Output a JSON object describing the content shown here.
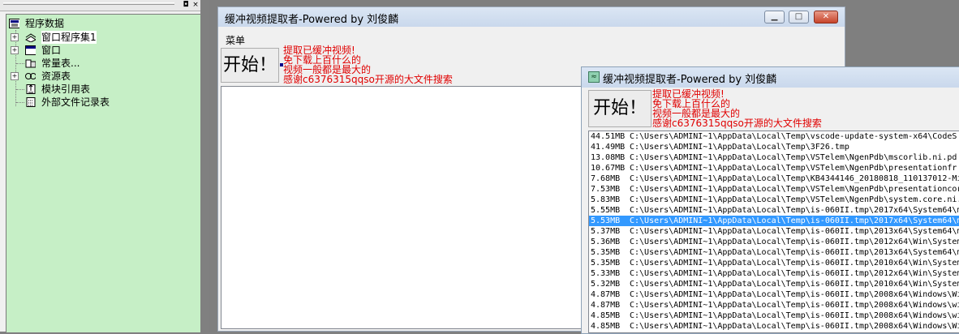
{
  "tree": {
    "root": "程序数据",
    "items": [
      {
        "label": "窗口程序集1",
        "icon": "module-icon",
        "expandable": true
      },
      {
        "label": "窗口",
        "icon": "window-icon",
        "expandable": true
      },
      {
        "label": "常量表...",
        "icon": "constant-icon",
        "expandable": false
      },
      {
        "label": "资源表",
        "icon": "resource-icon",
        "expandable": true
      },
      {
        "label": "模块引用表",
        "icon": "module-ref-icon",
        "expandable": false
      },
      {
        "label": "外部文件记录表",
        "icon": "file-icon",
        "expandable": false
      }
    ]
  },
  "left_panel": {
    "restore_glyph": "◘",
    "close_glyph": "×"
  },
  "win1": {
    "title": "缓冲视频提取者-Powered by 刘俊麟",
    "menu": "菜单",
    "start": "开始！",
    "notes": [
      "提取已缓冲视频!",
      "免下载上百什么的",
      "视频一般都是最大的",
      "感谢c6376315qqso开源的大文件搜索"
    ]
  },
  "win2": {
    "title": "缓冲视频提取者-Powered by 刘俊麟",
    "start": "开始！",
    "notes": [
      "提取已缓冲视频!",
      "免下载上百什么的",
      "视频一般都是最大的",
      "感谢c6376315qqso开源的大文件搜索"
    ],
    "rows": [
      {
        "size": "44.51MB",
        "path": "C:\\Users\\ADMINI~1\\AppData\\Local\\Temp\\vscode-update-system-x64\\CodeS"
      },
      {
        "size": "41.49MB",
        "path": "C:\\Users\\ADMINI~1\\AppData\\Local\\Temp\\3F26.tmp"
      },
      {
        "size": "13.08MB",
        "path": "C:\\Users\\ADMINI~1\\AppData\\Local\\Temp\\VSTelem\\NgenPdb\\mscorlib.ni.pd"
      },
      {
        "size": "10.67MB",
        "path": "C:\\Users\\ADMINI~1\\AppData\\Local\\Temp\\VSTelem\\NgenPdb\\presentationfr"
      },
      {
        "size": "7.68MB",
        "path": "C:\\Users\\ADMINI~1\\AppData\\Local\\Temp\\KB4344146_20180818_110137012-Mi"
      },
      {
        "size": "7.53MB",
        "path": "C:\\Users\\ADMINI~1\\AppData\\Local\\Temp\\VSTelem\\NgenPdb\\presentationcor"
      },
      {
        "size": "5.83MB",
        "path": "C:\\Users\\ADMINI~1\\AppData\\Local\\Temp\\VSTelem\\NgenPdb\\system.core.ni."
      },
      {
        "size": "5.55MB",
        "path": "C:\\Users\\ADMINI~1\\AppData\\Local\\Temp\\is-060II.tmp\\2017x64\\System64\\m"
      },
      {
        "size": "5.53MB",
        "path": "C:\\Users\\ADMINI~1\\AppData\\Local\\Temp\\is-060II.tmp\\2017x64\\System64\\m",
        "selected": true
      },
      {
        "size": "5.37MB",
        "path": "C:\\Users\\ADMINI~1\\AppData\\Local\\Temp\\is-060II.tmp\\2013x64\\System64\\m"
      },
      {
        "size": "5.36MB",
        "path": "C:\\Users\\ADMINI~1\\AppData\\Local\\Temp\\is-060II.tmp\\2012x64\\Win\\System"
      },
      {
        "size": "5.35MB",
        "path": "C:\\Users\\ADMINI~1\\AppData\\Local\\Temp\\is-060II.tmp\\2013x64\\System64\\m"
      },
      {
        "size": "5.35MB",
        "path": "C:\\Users\\ADMINI~1\\AppData\\Local\\Temp\\is-060II.tmp\\2010x64\\Win\\System"
      },
      {
        "size": "5.33MB",
        "path": "C:\\Users\\ADMINI~1\\AppData\\Local\\Temp\\is-060II.tmp\\2012x64\\Win\\System"
      },
      {
        "size": "5.32MB",
        "path": "C:\\Users\\ADMINI~1\\AppData\\Local\\Temp\\is-060II.tmp\\2010x64\\Win\\System"
      },
      {
        "size": "4.87MB",
        "path": "C:\\Users\\ADMINI~1\\AppData\\Local\\Temp\\is-060II.tmp\\2008x64\\Windows\\Wi"
      },
      {
        "size": "4.87MB",
        "path": "C:\\Users\\ADMINI~1\\AppData\\Local\\Temp\\is-060II.tmp\\2008x64\\Windows\\wi"
      },
      {
        "size": "4.85MB",
        "path": "C:\\Users\\ADMINI~1\\AppData\\Local\\Temp\\is-060II.tmp\\2008x64\\Windows\\wi"
      },
      {
        "size": "4.85MB",
        "path": "C:\\Users\\ADMINI~1\\AppData\\Local\\Temp\\is-060II.tmp\\2008x64\\Windows\\Wi"
      }
    ]
  },
  "colors": {
    "tree_bg": "#c6efc6",
    "note_red": "#e00000",
    "selection": "#3399ff"
  }
}
